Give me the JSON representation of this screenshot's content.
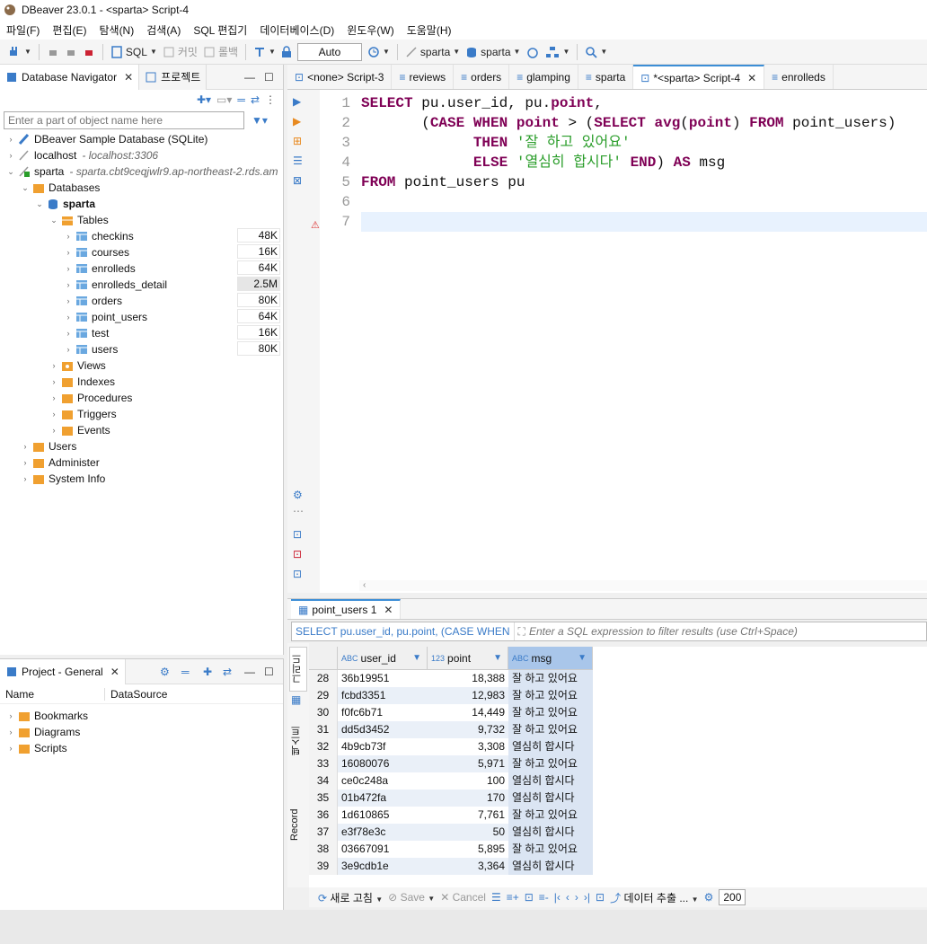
{
  "window": {
    "title": "DBeaver 23.0.1 - <sparta> Script-4"
  },
  "menu": [
    "파일(F)",
    "편집(E)",
    "탐색(N)",
    "검색(A)",
    "SQL 편집기",
    "데이터베이스(D)",
    "윈도우(W)",
    "도움말(H)"
  ],
  "toolbar": {
    "sql": "SQL",
    "commit": "커밋",
    "rollback": "롤백",
    "auto": "Auto",
    "conn1": "sparta",
    "conn2": "sparta"
  },
  "navigator": {
    "tab_label": "Database Navigator",
    "tab_project": "프로젝트",
    "filter_placeholder": "Enter a part of object name here",
    "conn_sqlite": "DBeaver Sample Database (SQLite)",
    "conn_local": "localhost",
    "conn_local_host": "- localhost:3306",
    "conn_sparta": "sparta",
    "conn_sparta_host": "- sparta.cbt9ceqjwlr9.ap-northeast-2.rds.am",
    "databases": "Databases",
    "db_sparta": "sparta",
    "tables_label": "Tables",
    "tables": [
      {
        "name": "checkins",
        "size": "48K"
      },
      {
        "name": "courses",
        "size": "16K"
      },
      {
        "name": "enrolleds",
        "size": "64K"
      },
      {
        "name": "enrolleds_detail",
        "size": "2.5M"
      },
      {
        "name": "orders",
        "size": "80K"
      },
      {
        "name": "point_users",
        "size": "64K"
      },
      {
        "name": "test",
        "size": "16K"
      },
      {
        "name": "users",
        "size": "80K"
      }
    ],
    "folders": [
      "Views",
      "Indexes",
      "Procedures",
      "Triggers",
      "Events"
    ],
    "others": [
      "Users",
      "Administer",
      "System Info"
    ]
  },
  "project": {
    "tab_label": "Project - General",
    "col_name": "Name",
    "col_source": "DataSource",
    "items": [
      "Bookmarks",
      "Diagrams",
      "Scripts"
    ]
  },
  "editor_tabs": [
    {
      "label": "<none> Script-3",
      "active": false
    },
    {
      "label": "reviews",
      "active": false
    },
    {
      "label": "orders",
      "active": false
    },
    {
      "label": "glamping",
      "active": false
    },
    {
      "label": "sparta",
      "active": false
    },
    {
      "label": "*<sparta> Script-4",
      "active": true
    },
    {
      "label": "enrolleds",
      "active": false
    }
  ],
  "editor": {
    "line_numbers": [
      "1",
      "2",
      "3",
      "4",
      "5",
      "6",
      "7"
    ],
    "lines": [
      [
        {
          "t": "SELECT",
          "k": "kw"
        },
        {
          "t": " pu.user_id, pu.",
          "k": ""
        },
        {
          "t": "point",
          "k": "kw"
        },
        {
          "t": ",",
          "k": ""
        }
      ],
      [
        {
          "t": "       (",
          "k": ""
        },
        {
          "t": "CASE",
          "k": "kw"
        },
        {
          "t": " ",
          "k": ""
        },
        {
          "t": "WHEN",
          "k": "kw"
        },
        {
          "t": " ",
          "k": ""
        },
        {
          "t": "point",
          "k": "kw"
        },
        {
          "t": " > (",
          "k": ""
        },
        {
          "t": "SELECT",
          "k": "kw"
        },
        {
          "t": " ",
          "k": ""
        },
        {
          "t": "avg",
          "k": "kw"
        },
        {
          "t": "(",
          "k": ""
        },
        {
          "t": "point",
          "k": "kw"
        },
        {
          "t": ") ",
          "k": ""
        },
        {
          "t": "FROM",
          "k": "kw"
        },
        {
          "t": " point_users)",
          "k": ""
        }
      ],
      [
        {
          "t": "             ",
          "k": ""
        },
        {
          "t": "THEN",
          "k": "kw"
        },
        {
          "t": " ",
          "k": ""
        },
        {
          "t": "'잘 하고 있어요'",
          "k": "str"
        }
      ],
      [
        {
          "t": "             ",
          "k": ""
        },
        {
          "t": "ELSE",
          "k": "kw"
        },
        {
          "t": " ",
          "k": ""
        },
        {
          "t": "'열심히 합시다'",
          "k": "str"
        },
        {
          "t": " ",
          "k": ""
        },
        {
          "t": "END",
          "k": "kw"
        },
        {
          "t": ") ",
          "k": ""
        },
        {
          "t": "AS",
          "k": "kw"
        },
        {
          "t": " msg",
          "k": ""
        }
      ],
      [
        {
          "t": "FROM",
          "k": "kw"
        },
        {
          "t": " point_users pu",
          "k": ""
        }
      ],
      [],
      []
    ]
  },
  "results": {
    "tab_label": "point_users 1",
    "query_label": "SELECT pu.user_id, pu.point, (CASE WHEN",
    "filter_placeholder": "Enter a SQL expression to filter results (use Ctrl+Space)",
    "side_tabs": [
      "그리드",
      "텍스트",
      "Record"
    ],
    "columns": [
      "user_id",
      "point",
      "msg"
    ],
    "rows": [
      [
        "28",
        "36b19951",
        "18,388",
        "잘 하고 있어요"
      ],
      [
        "29",
        "fcbd3351",
        "12,983",
        "잘 하고 있어요"
      ],
      [
        "30",
        "f0fc6b71",
        "14,449",
        "잘 하고 있어요"
      ],
      [
        "31",
        "dd5d3452",
        "9,732",
        "잘 하고 있어요"
      ],
      [
        "32",
        "4b9cb73f",
        "3,308",
        "열심히 합시다"
      ],
      [
        "33",
        "16080076",
        "5,971",
        "잘 하고 있어요"
      ],
      [
        "34",
        "ce0c248a",
        "100",
        "열심히 합시다"
      ],
      [
        "35",
        "01b472fa",
        "170",
        "열심히 합시다"
      ],
      [
        "36",
        "1d610865",
        "7,761",
        "잘 하고 있어요"
      ],
      [
        "37",
        "e3f78e3c",
        "50",
        "열심히 합시다"
      ],
      [
        "38",
        "03667091",
        "5,895",
        "잘 하고 있어요"
      ],
      [
        "39",
        "3e9cdb1e",
        "3,364",
        "열심히 합시다"
      ]
    ],
    "bottom": {
      "refresh": "새로 고침",
      "save": "Save",
      "cancel": "Cancel",
      "export": "데이터 추출 ...",
      "fetch": "200"
    }
  }
}
